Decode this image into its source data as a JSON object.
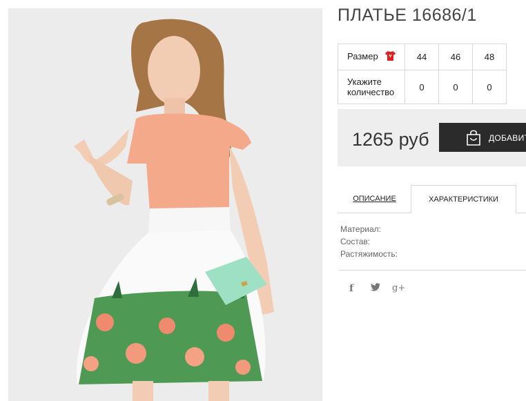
{
  "product": {
    "title": "ПЛАТЬЕ 16686/1",
    "image_alt": "model in peach top and white floral skirt with mint clutch"
  },
  "sizes_table": {
    "size_label": "Размер",
    "sizes": [
      "44",
      "46",
      "48"
    ],
    "quantity_label_line1": "Укажите",
    "quantity_label_line2": "количество",
    "quantities": [
      "0",
      "0",
      "0"
    ]
  },
  "purchase": {
    "price": "1265 руб",
    "add_button_label": "ДОБАВИТЬ"
  },
  "tabs": {
    "description": "ОПИСАНИЕ",
    "characteristics": "ХАРАКТЕРИСТИКИ"
  },
  "specs": {
    "material": "Материал:",
    "composition": "Состав:",
    "stretch": "Растяжимость:"
  },
  "social": {
    "facebook": "f",
    "twitter": "t",
    "googleplus": "g+"
  },
  "colors": {
    "button_bg": "#2b2b2b",
    "price_box_bg": "#eeeeee",
    "size_icon": "#e02020"
  }
}
